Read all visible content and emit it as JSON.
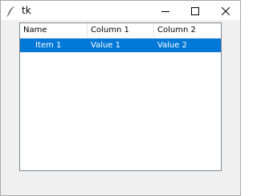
{
  "window": {
    "title": "tk"
  },
  "tree": {
    "columns": [
      "Name",
      "Column 1",
      "Column 2"
    ],
    "rows": [
      {
        "name": "Item 1",
        "col1": "Value 1",
        "col2": "Value 2",
        "selected": true
      }
    ]
  },
  "icons": {
    "app": "feather-icon",
    "minimize": "minimize-icon",
    "maximize": "maximize-icon",
    "close": "close-icon"
  },
  "colors": {
    "selection": "#0078d7",
    "window_bg": "#f0f0f0"
  }
}
